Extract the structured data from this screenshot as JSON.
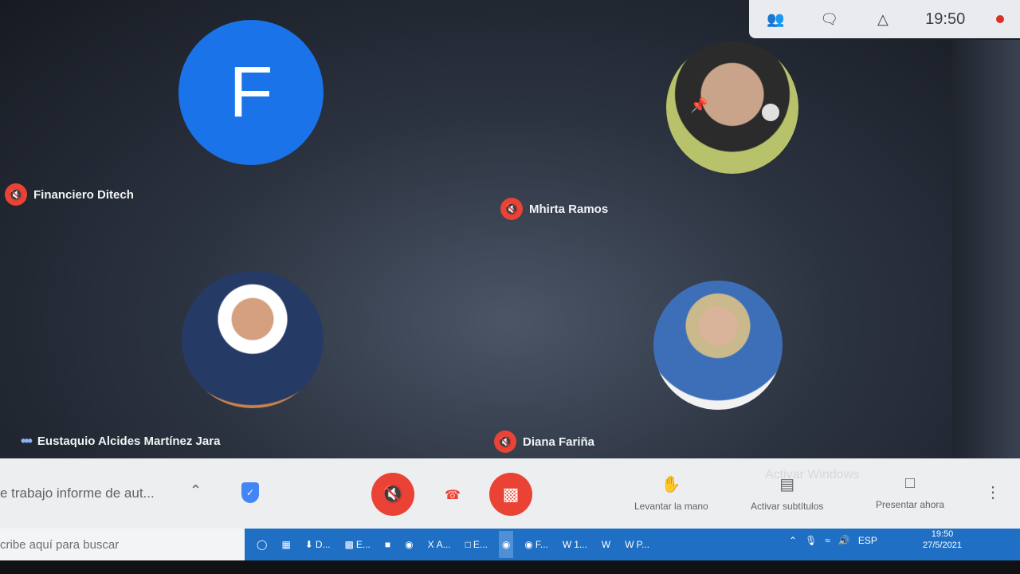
{
  "top_bar": {
    "people_icon": "people-icon",
    "chat_icon": "chat-icon",
    "activities_icon": "activities-icon",
    "time": "19:50"
  },
  "participants": [
    {
      "name": "Financiero Ditech",
      "avatar_letter": "F",
      "muted": true
    },
    {
      "name": "Mhirta Ramos",
      "muted": true
    },
    {
      "name": "Eustaquio Alcides Martínez Jara",
      "muted": false
    },
    {
      "name": "Diana Fariña",
      "muted": true
    }
  ],
  "controls": {
    "meeting_title": "e trabajo informe de aut...",
    "raise_hand": "Levantar la mano",
    "captions": "Activar subtítulos",
    "present": "Presentar ahora",
    "watermark": "Activar Windows"
  },
  "taskbar": {
    "search_placeholder": "cribe aquí para buscar",
    "items": [
      "D...",
      "E...",
      "A...",
      "E...",
      "F...",
      "1...",
      "P..."
    ],
    "lang": "ESP",
    "time": "19:50",
    "date": "27/5/2021"
  },
  "colors": {
    "accent": "#1a73e8",
    "danger": "#ea4335",
    "taskbar": "#1f6fc4"
  }
}
